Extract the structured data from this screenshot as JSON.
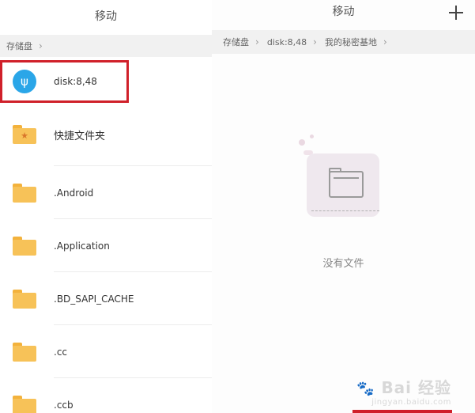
{
  "left_panel": {
    "title": "移动",
    "breadcrumb": [
      "存储盘"
    ],
    "items": [
      {
        "label": "disk:8,48",
        "icon": "usb-drive-icon"
      },
      {
        "label": "快捷文件夹",
        "icon": "star-folder-icon"
      },
      {
        "label": ".Android",
        "icon": "folder-icon"
      },
      {
        "label": ".Application",
        "icon": "folder-icon"
      },
      {
        "label": ".BD_SAPI_CACHE",
        "icon": "folder-icon"
      },
      {
        "label": ".cc",
        "icon": "folder-icon"
      },
      {
        "label": ".ccb",
        "icon": "folder-icon"
      }
    ],
    "highlight_color": "#d0202a"
  },
  "right_panel": {
    "title": "移动",
    "add_icon": "plus-icon",
    "breadcrumb": [
      "存储盘",
      "disk:8,48",
      "我的秘密基地"
    ],
    "empty_text": "没有文件",
    "empty_icon": "empty-folder-icon"
  },
  "watermark": {
    "logo": "Bai 经验",
    "url": "jingyan.baidu.com"
  },
  "colors": {
    "folder": "#f7c258",
    "usb_icon_bg": "#2aa6e8",
    "accent_red": "#d0202a",
    "breadcrumb_bg": "#f1f1f1"
  }
}
